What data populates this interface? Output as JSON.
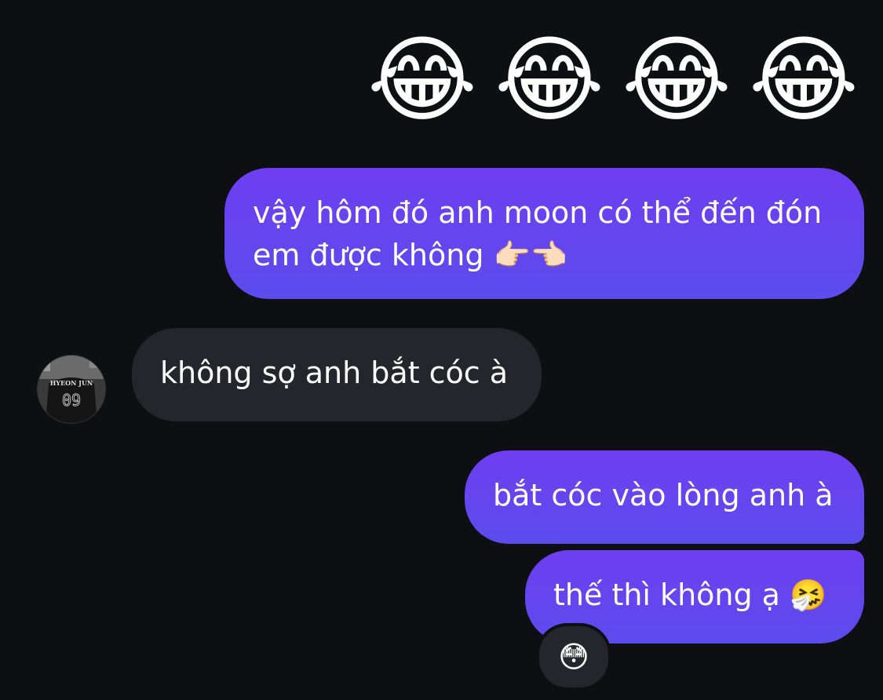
{
  "emoji_row": {
    "emojis": [
      "😂",
      "😂",
      "😂",
      "😂"
    ]
  },
  "messages": [
    {
      "id": "msg1",
      "sender": "me",
      "text": "vậy hôm đó anh moon có thể đến đón em được không 👉🏻👈🏻"
    },
    {
      "id": "msg2",
      "sender": "them",
      "text": "không sợ anh bắt cóc à"
    },
    {
      "id": "msg3",
      "sender": "me",
      "text": "bắt cóc vào lòng anh à"
    },
    {
      "id": "msg4",
      "sender": "me",
      "text": "thế thì không ạ 🤧"
    }
  ],
  "avatar": {
    "shirt_name": "HYEON JUN",
    "shirt_number": "09"
  },
  "reaction": {
    "emoji": "😳"
  },
  "colors": {
    "background": "#0d0f12",
    "outgoing_bubble": "#6a3ff0",
    "incoming_bubble": "#24262b"
  }
}
